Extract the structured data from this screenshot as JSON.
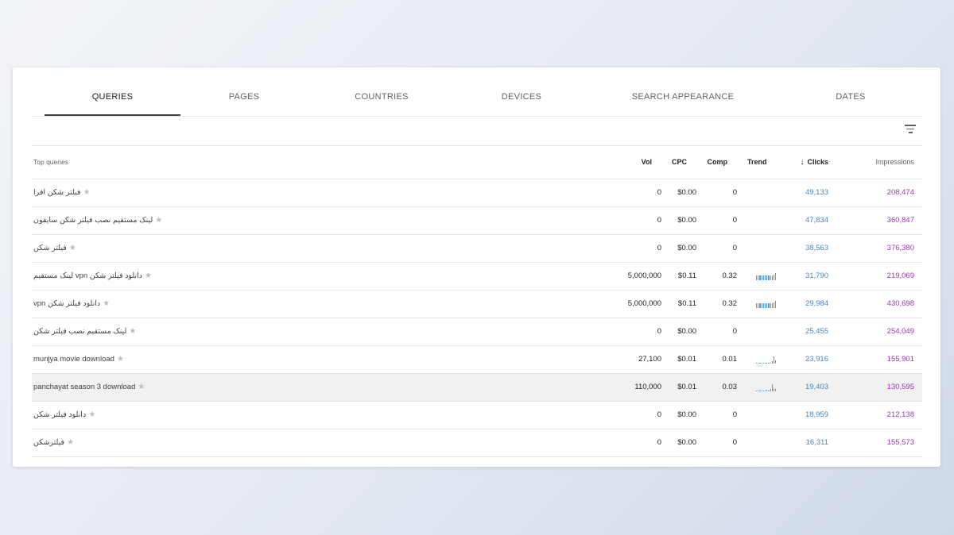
{
  "tabs": [
    "QUERIES",
    "PAGES",
    "COUNTRIES",
    "DEVICES",
    "SEARCH APPEARANCE",
    "DATES"
  ],
  "active_tab": "QUERIES",
  "filter_icon": "filter-list-icon",
  "table": {
    "headers": {
      "query": "Top queries",
      "vol": "Vol",
      "cpc": "CPC",
      "comp": "Comp",
      "trend": "Trend",
      "clicks": "Clicks",
      "impressions": "Impressions",
      "sort_icon": "arrow-down-icon"
    },
    "rows": [
      {
        "query": "فیلتر شکن افرا",
        "vol": "0",
        "cpc": "$0.00",
        "comp": "0",
        "trend": [],
        "clicks": "49,133",
        "impressions": "208,474"
      },
      {
        "query": "لینک مستقیم نصب فیلتر شکن سایفون",
        "vol": "0",
        "cpc": "$0.00",
        "comp": "0",
        "trend": [],
        "clicks": "47,834",
        "impressions": "360,847"
      },
      {
        "query": "فیلتر شکن",
        "vol": "0",
        "cpc": "$0.00",
        "comp": "0",
        "trend": [],
        "clicks": "38,563",
        "impressions": "376,380"
      },
      {
        "query": "لینک مستقیم vpn دانلود فیلتر شکن",
        "vol": "5,000,000",
        "cpc": "$0.11",
        "comp": "0.32",
        "trend": [
          0.7,
          0.7,
          0.7,
          0.7,
          0.7,
          0.7,
          0.7,
          0.7,
          0.7,
          0.7,
          0.8,
          1
        ],
        "clicks": "31,790",
        "impressions": "219,069"
      },
      {
        "query": "vpn دانلود فیلتر شکن",
        "vol": "5,000,000",
        "cpc": "$0.11",
        "comp": "0.32",
        "trend": [
          0.7,
          0.7,
          0.7,
          0.7,
          0.7,
          0.7,
          0.7,
          0.7,
          0.7,
          0.7,
          0.8,
          1
        ],
        "clicks": "29,984",
        "impressions": "430,698"
      },
      {
        "query": "لینک مستقیم نصب فیلتر شکن",
        "vol": "0",
        "cpc": "$0.00",
        "comp": "0",
        "trend": [],
        "clicks": "25,455",
        "impressions": "254,049"
      },
      {
        "query": "munjya movie download",
        "vol": "27,100",
        "cpc": "$0.01",
        "comp": "0.01",
        "trend": [
          0.1,
          0.1,
          0.1,
          0.1,
          0.1,
          0.1,
          0.1,
          0.1,
          0.1,
          0.3,
          1,
          0.4
        ],
        "clicks": "23,916",
        "impressions": "155,901"
      },
      {
        "query": "panchayat season 3 download",
        "vol": "110,000",
        "cpc": "$0.01",
        "comp": "0.03",
        "trend": [
          0.1,
          0.15,
          0.1,
          0.1,
          0.15,
          0.1,
          0.2,
          0.15,
          0.3,
          1,
          0.4,
          0.3
        ],
        "clicks": "19,403",
        "impressions": "130,595",
        "highlighted": true
      },
      {
        "query": "دانلود فیلتر شکن",
        "vol": "0",
        "cpc": "$0.00",
        "comp": "0",
        "trend": [],
        "clicks": "18,959",
        "impressions": "212,138"
      },
      {
        "query": "فیلترشکن",
        "vol": "0",
        "cpc": "$0.00",
        "comp": "0",
        "trend": [],
        "clicks": "16,311",
        "impressions": "155,573"
      }
    ]
  }
}
